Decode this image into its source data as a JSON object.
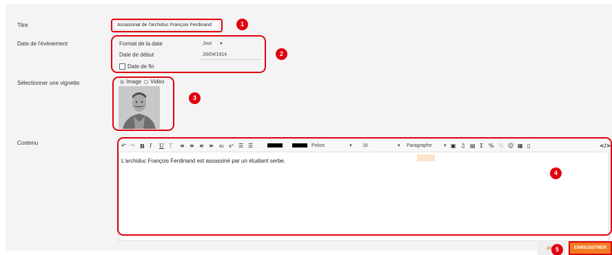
{
  "form": {
    "title_label": "Titre",
    "title_value": "Assassinat de l'archiduc François Ferdinand",
    "date_label": "Date de l'évènement",
    "date_format_label": "Format de la date",
    "date_format_value": "Jour",
    "start_date_label": "Date de début",
    "start_date_value": "28/04/1914",
    "end_date_label": "Date de fin",
    "thumbnail_label": "Sélectionner une vignette",
    "thumb_option_image": "Image",
    "thumb_option_video": "Vidéo",
    "content_label": "Contenu",
    "content_text": "L'archiduc François Ferdinand est assassiné par un étudiant serbe."
  },
  "toolbar": {
    "font_label": "Police",
    "font_size": "16",
    "paragraph_label": "Paragraphe",
    "code_glyph": "</>"
  },
  "buttons": {
    "cancel_label": "ANN",
    "save_label": "ENREGISTRER"
  },
  "markers": [
    "1",
    "2",
    "3",
    "4",
    "5"
  ],
  "colors": {
    "accent": "#f47c20",
    "annotation": "#e0000e"
  }
}
